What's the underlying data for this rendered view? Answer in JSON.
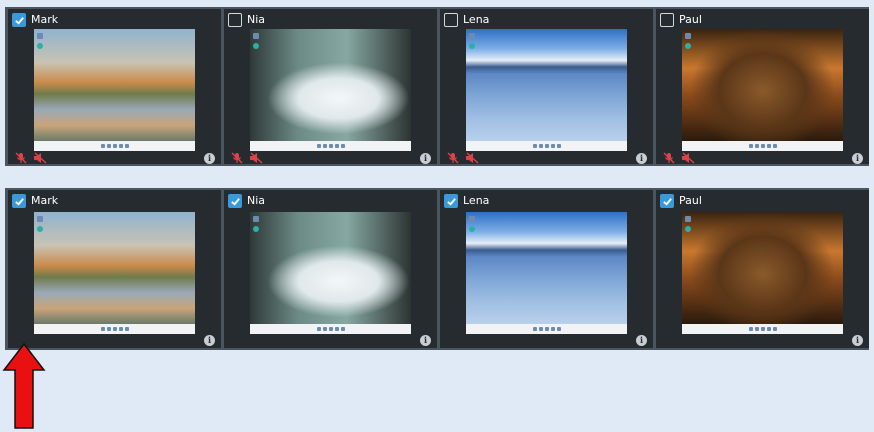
{
  "top_panel": {
    "tiles": [
      {
        "name": "Mark",
        "checked": true,
        "muted": true
      },
      {
        "name": "Nia",
        "checked": false,
        "muted": true
      },
      {
        "name": "Lena",
        "checked": false,
        "muted": true
      },
      {
        "name": "Paul",
        "checked": false,
        "muted": true
      }
    ]
  },
  "bottom_panel": {
    "tiles": [
      {
        "name": "Mark",
        "checked": true
      },
      {
        "name": "Nia",
        "checked": true
      },
      {
        "name": "Lena",
        "checked": true
      },
      {
        "name": "Paul",
        "checked": true
      }
    ]
  },
  "info_glyph": "i",
  "colors": {
    "accent": "#3a9ad9",
    "muted_icon": "#e0404a",
    "annotation_arrow": "#e81010"
  },
  "icons": {
    "checkbox": "checkmark-icon",
    "mic": "mic-muted-icon",
    "speaker": "speaker-muted-icon",
    "info": "info-icon",
    "annotation": "up-arrow-annotation"
  }
}
